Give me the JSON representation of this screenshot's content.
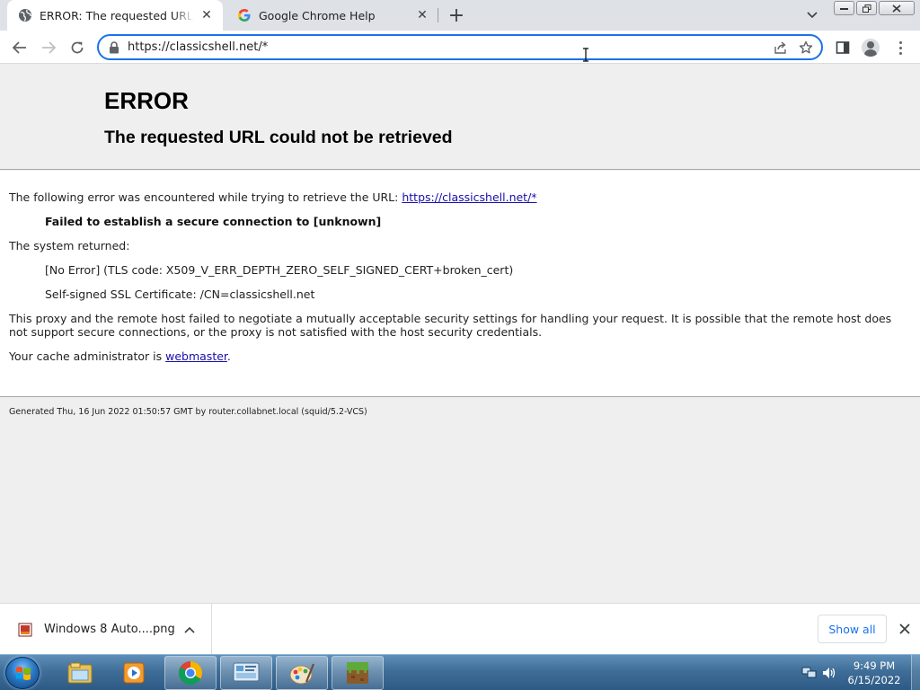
{
  "browser": {
    "tabs": [
      {
        "title": "ERROR: The requested URL could not be retrieved",
        "icon": "globe-icon",
        "active": true
      },
      {
        "title": "Google Chrome Help",
        "icon": "google-icon",
        "active": false
      }
    ],
    "address_bar": {
      "url": "https://classicshell.net/*"
    }
  },
  "page": {
    "heading": "ERROR",
    "subheading": "The requested URL could not be retrieved",
    "intro_text": "The following error was encountered while trying to retrieve the URL: ",
    "intro_link": "https://classicshell.net/*",
    "error_detail": "Failed to establish a secure connection to [unknown]",
    "system_returned_label": "The system returned:",
    "tls_error": "[No Error] (TLS code: X509_V_ERR_DEPTH_ZERO_SELF_SIGNED_CERT+broken_cert)",
    "cert_info": "Self-signed SSL Certificate: /CN=classicshell.net",
    "explanation": "This proxy and the remote host failed to negotiate a mutually acceptable security settings for handling your request. It is possible that the remote host does not support secure connections, or the proxy is not satisfied with the host security credentials.",
    "admin_prefix": "Your cache administrator is ",
    "admin_link": "webmaster",
    "admin_suffix": ".",
    "footer": "Generated Thu, 16 Jun 2022 01:50:57 GMT by router.collabnet.local (squid/5.2-VCS)"
  },
  "downloads": {
    "item_name": "Windows 8 Auto....png",
    "show_all": "Show all"
  },
  "taskbar": {
    "apps": [
      "file-explorer-icon",
      "media-player-icon",
      "chrome-icon",
      "control-panel-icon",
      "paint-icon",
      "minecraft-icon"
    ],
    "time": "9:49 PM",
    "date": "6/15/2022"
  },
  "colors": {
    "accent": "#1a73e8",
    "link": "#1a0dab",
    "page_background": "#efefef"
  }
}
